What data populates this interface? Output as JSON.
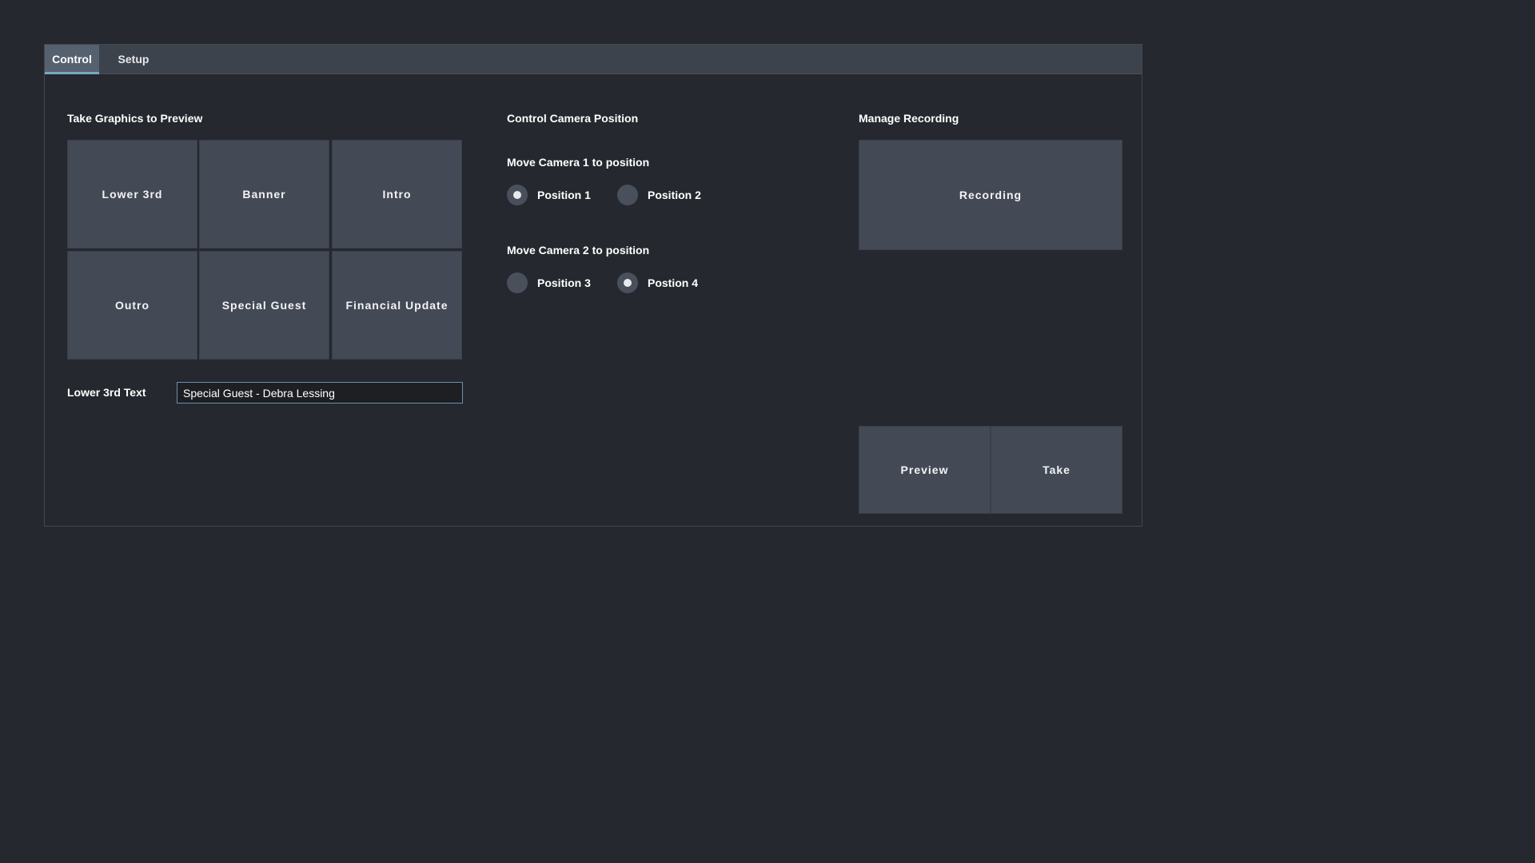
{
  "tabs": [
    {
      "label": "Control",
      "active": true
    },
    {
      "label": "Setup",
      "active": false
    }
  ],
  "graphics": {
    "title": "Take Graphics to Preview",
    "buttons": [
      "Lower 3rd",
      "Banner",
      "Intro",
      "Outro",
      "Special Guest",
      "Financial Update"
    ],
    "lower3rd_label": "Lower 3rd Text",
    "lower3rd_value": "Special Guest - Debra Lessing"
  },
  "camera": {
    "title": "Control Camera Position",
    "cam1": {
      "label": "Move Camera 1 to position",
      "options": [
        {
          "label": "Position 1",
          "checked": true
        },
        {
          "label": "Position 2",
          "checked": false
        }
      ]
    },
    "cam2": {
      "label": "Move Camera 2 to position",
      "options": [
        {
          "label": "Position 3",
          "checked": false
        },
        {
          "label": "Postion 4",
          "checked": true
        }
      ]
    }
  },
  "recording": {
    "title": "Manage Recording",
    "record_label": "Recording",
    "preview_label": "Preview",
    "take_label": "Take"
  },
  "colors": {
    "background": "#25282e",
    "tabbar": "#3d434d",
    "active_tab": "#566170",
    "active_tab_underline": "#7aa6c2",
    "button": "#444a55",
    "input_border": "#6d8fa8"
  }
}
